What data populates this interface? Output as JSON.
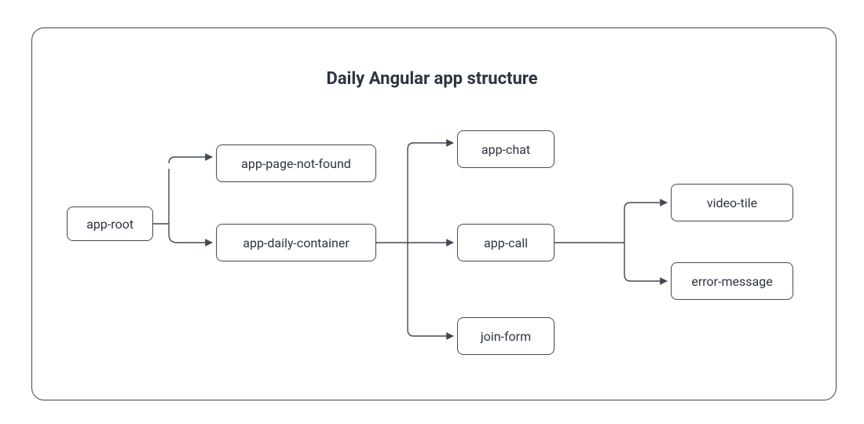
{
  "title": "Daily Angular app structure",
  "nodes": {
    "root": "app-root",
    "pageNotFound": "app-page-not-found",
    "dailyContainer": "app-daily-container",
    "chat": "app-chat",
    "call": "app-call",
    "joinForm": "join-form",
    "videoTile": "video-tile",
    "errorMessage": "error-message"
  },
  "structure": {
    "app-root": {
      "children": [
        "app-page-not-found",
        "app-daily-container"
      ]
    },
    "app-daily-container": {
      "children": [
        "app-chat",
        "app-call",
        "join-form"
      ]
    },
    "app-call": {
      "children": [
        "video-tile",
        "error-message"
      ]
    }
  },
  "colors": {
    "stroke": "#424954",
    "text": "#2d3440",
    "background": "#ffffff"
  }
}
